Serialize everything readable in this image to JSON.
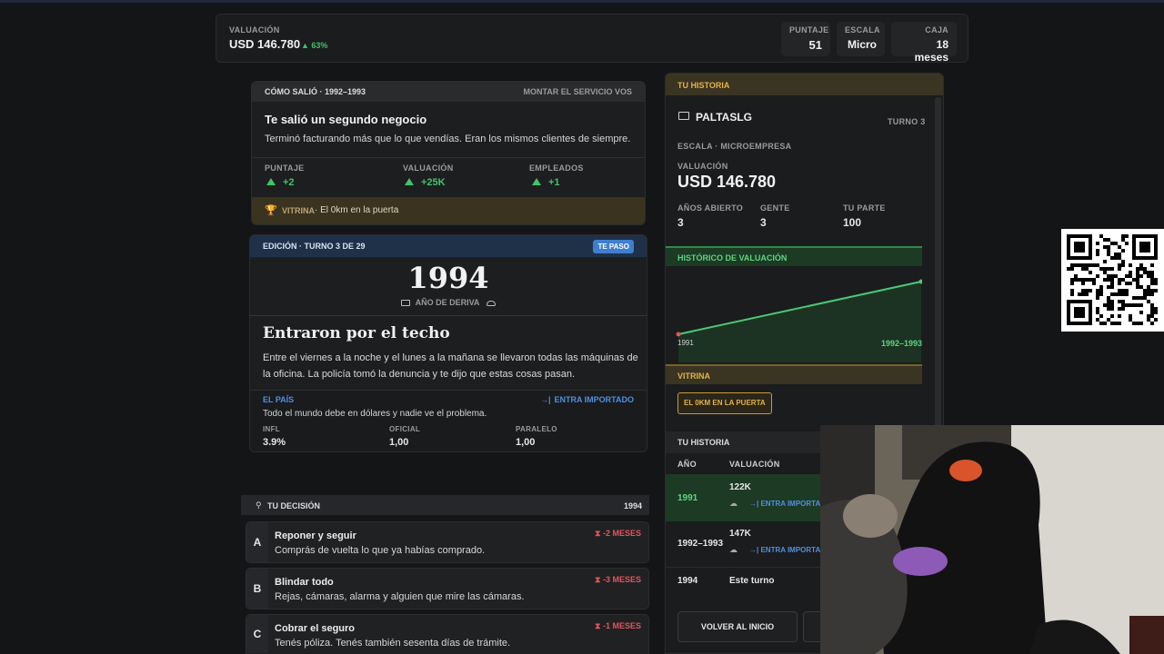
{
  "topbar": {
    "valuation_label": "VALUACIÓN",
    "valuation_value": "USD 146.780",
    "valuation_change": "▲ 63%",
    "stats": [
      {
        "label": "PUNTAJE",
        "value": "51"
      },
      {
        "label": "ESCALA",
        "value": "Micro"
      },
      {
        "label": "CAJA",
        "value": "18 meses"
      }
    ]
  },
  "outcome": {
    "header_left": "CÓMO SALIÓ · 1992–1993",
    "header_right": "MONTAR EL SERVICIO VOS",
    "title": "Te salió un segundo negocio",
    "description": "Terminó facturando más que lo que vendías. Eran los mismos clientes de siempre.",
    "metrics": [
      {
        "label": "PUNTAJE",
        "value": "+2"
      },
      {
        "label": "VALUACIÓN",
        "value": "+25K"
      },
      {
        "label": "EMPLEADOS",
        "value": "+1"
      }
    ],
    "vitrina_label": "VITRINA",
    "vitrina_text": " · El 0km en la puerta"
  },
  "edition": {
    "header": "EDICIÓN · TURNO 3 DE 29",
    "badge": "TE PASO",
    "year": "1994",
    "subtitle": "AÑO DE DERIVA",
    "headline": "Entraron por el techo",
    "body": "Entre el viernes a la noche y el lunes a la mañana se llevaron todas las máquinas de la oficina. La policía tomó la denuncia y te dijo que estas cosas pasan.",
    "country_label": "EL PAÍS",
    "country_action": "ENTRA IMPORTADO",
    "country_text": "Todo el mundo debe en dólares y nadie ve el problema.",
    "indicators": [
      {
        "label": "INFL",
        "value": "3.9%"
      },
      {
        "label": "OFICIAL",
        "value": "1,00"
      },
      {
        "label": "PARALELO",
        "value": "1,00"
      }
    ]
  },
  "decision": {
    "label": "TU DECISIÓN",
    "year": "1994",
    "options": [
      {
        "letter": "A",
        "title": "Reponer y seguir",
        "desc": "Comprás de vuelta lo que ya habías comprado.",
        "cost": "-2 MESES"
      },
      {
        "letter": "B",
        "title": "Blindar todo",
        "desc": "Rejas, cámaras, alarma y alguien que mire las cámaras.",
        "cost": "-3 MESES"
      },
      {
        "letter": "C",
        "title": "Cobrar el seguro",
        "desc": "Tenés póliza. Tenés también sesenta días de trámite.",
        "cost": "-1 MESES"
      }
    ]
  },
  "history": {
    "header": "TU HISTORIA",
    "company": "PALTASLG",
    "turn": "TURNO 3",
    "scale": "ESCALA · MICROEMPRESA",
    "valuation_label": "VALUACIÓN",
    "valuation": "USD 146.780",
    "stats": [
      {
        "label": "AÑOS ABIERTO",
        "value": "3"
      },
      {
        "label": "GENTE",
        "value": "3"
      },
      {
        "label": "TU PARTE",
        "value": "100"
      }
    ],
    "chart_header": "HISTÓRICO DE VALUACIÓN",
    "chart_start": "1991",
    "chart_end": "1992–1993",
    "vitrina_header": "VITRINA",
    "vitrina_item": "EL 0KM EN LA PUERTA",
    "table_header": "TU HISTORIA",
    "col_year": "AÑO",
    "col_val": "VALUACIÓN",
    "rows": [
      {
        "year": "1991",
        "value": "122K",
        "tag": "ENTRA IMPORTA"
      },
      {
        "year": "1992–1993",
        "value": "147K",
        "tag": "ENTRA IMPORTA"
      },
      {
        "year": "1994",
        "value": "Este turno",
        "tag": ""
      }
    ],
    "back_button": "VOLVER AL INICIO"
  },
  "colors": {
    "accent_green": "#3fc46a",
    "gold": "#e5b347",
    "cost_red": "#e0555b",
    "badge_blue": "#3f7fd0"
  }
}
